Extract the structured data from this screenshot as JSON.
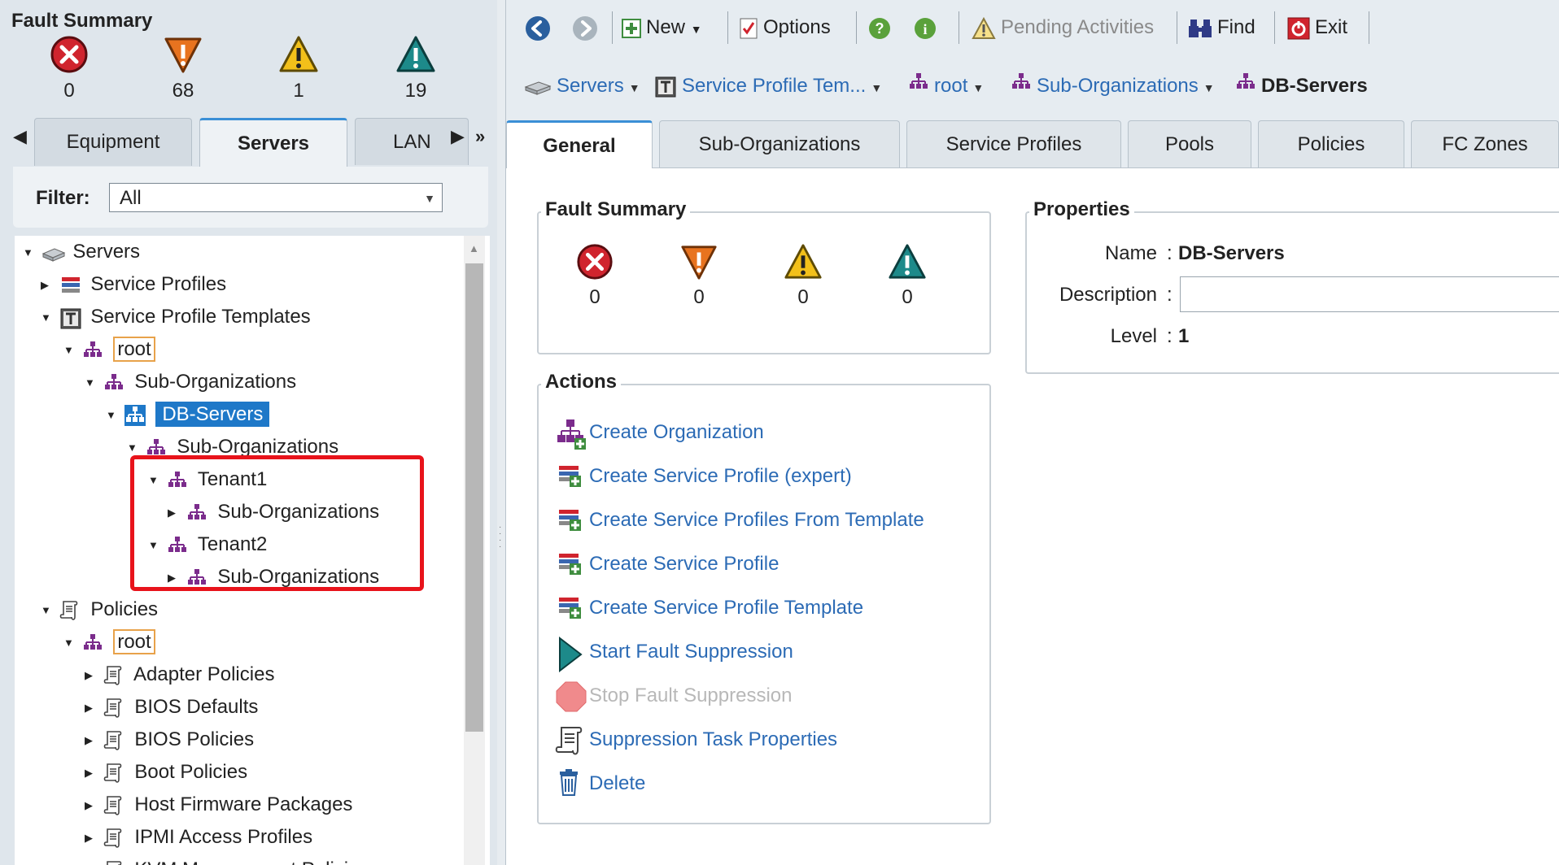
{
  "left_fault_summary": {
    "title": "Fault Summary",
    "critical": "0",
    "major": "68",
    "minor": "1",
    "warning": "19"
  },
  "nav_tabs": [
    "Equipment",
    "Servers",
    "LAN"
  ],
  "filter": {
    "label": "Filter:",
    "value": "All"
  },
  "tree": {
    "servers": "Servers",
    "service_profiles": "Service Profiles",
    "service_profile_templates": "Service Profile Templates",
    "root": "root",
    "sub_orgs_1": "Sub-Organizations",
    "db_servers": "DB-Servers",
    "sub_orgs_2": "Sub-Organizations",
    "tenant1": "Tenant1",
    "tenant1_sub": "Sub-Organizations",
    "tenant2": "Tenant2",
    "tenant2_sub": "Sub-Organizations",
    "policies": "Policies",
    "policies_root": "root",
    "adapter_policies": "Adapter Policies",
    "bios_defaults": "BIOS Defaults",
    "bios_policies": "BIOS Policies",
    "boot_policies": "Boot Policies",
    "host_firmware": "Host Firmware Packages",
    "ipmi_profiles": "IPMI Access Profiles",
    "kvm_partial": "KVM Management Policies"
  },
  "toolbar": {
    "new": "New",
    "options": "Options",
    "pending": "Pending Activities",
    "find": "Find",
    "exit": "Exit"
  },
  "breadcrumb": {
    "servers": "Servers",
    "templates": "Service Profile Tem...",
    "root": "root",
    "sub_orgs": "Sub-Organizations",
    "current": "DB-Servers"
  },
  "content_tabs": [
    "General",
    "Sub-Organizations",
    "Service Profiles",
    "Pools",
    "Policies",
    "FC Zones"
  ],
  "fault_summary": {
    "title": "Fault Summary",
    "critical": "0",
    "major": "0",
    "minor": "0",
    "warning": "0"
  },
  "properties": {
    "title": "Properties",
    "name_label": "Name",
    "name_value": "DB-Servers",
    "description_label": "Description",
    "description_value": "",
    "level_label": "Level",
    "level_value": "1",
    "colon": ":"
  },
  "actions": {
    "title": "Actions",
    "items": [
      "Create Organization",
      "Create Service Profile (expert)",
      "Create Service Profiles From Template",
      "Create Service Profile",
      "Create Service Profile Template",
      "Start Fault Suppression",
      "Stop Fault Suppression",
      "Suppression Task Properties",
      "Delete"
    ]
  },
  "colors": {
    "link": "#2c6bb5",
    "selection": "#1e78c8",
    "highlight_box": "#e8131b",
    "critical": "#d0242e",
    "major": "#e8731f",
    "minor": "#f2c01a",
    "warning": "#1d8a8a",
    "org_icon": "#7b2c8c"
  },
  "icons": {
    "critical": "critical-fault-icon",
    "major": "major-fault-icon",
    "minor": "minor-fault-icon",
    "warning": "warning-fault-icon",
    "org": "organization-icon"
  }
}
